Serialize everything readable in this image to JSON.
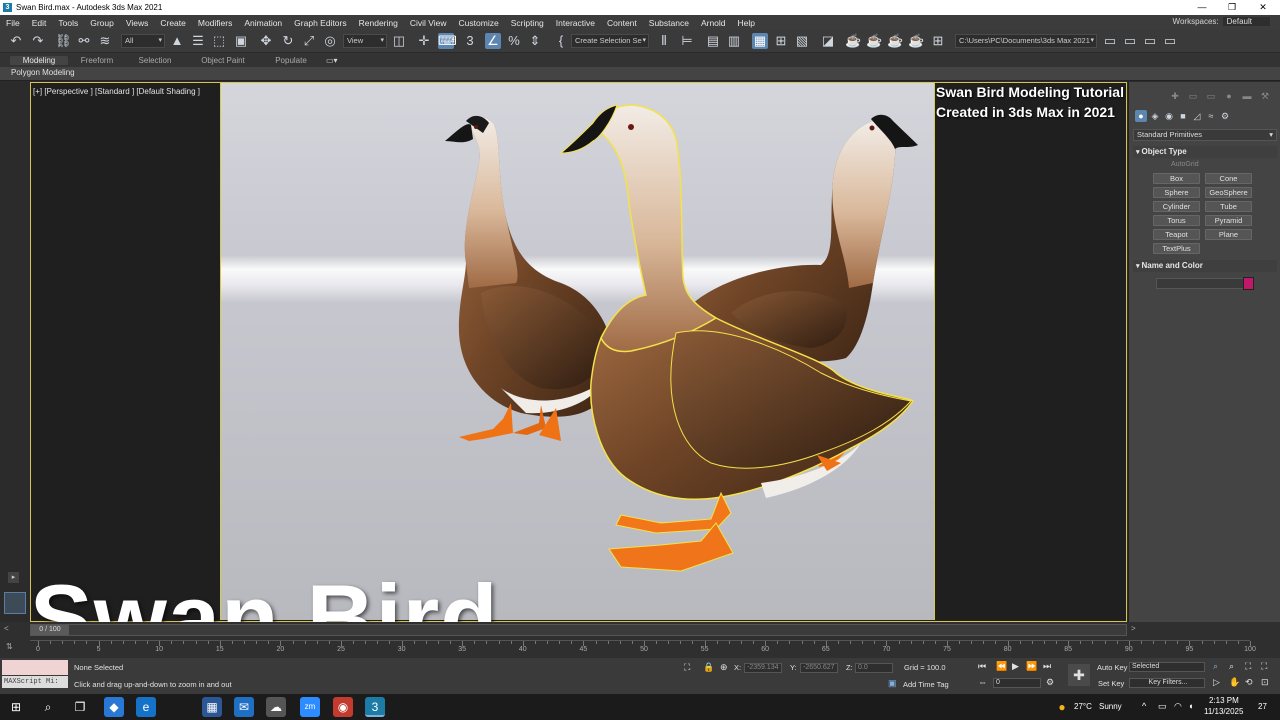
{
  "window": {
    "title": "Swan Bird.max - Autodesk 3ds Max 2021"
  },
  "menu": [
    "File",
    "Edit",
    "Tools",
    "Group",
    "Views",
    "Create",
    "Modifiers",
    "Animation",
    "Graph Editors",
    "Rendering",
    "Civil View",
    "Customize",
    "Scripting",
    "Interactive",
    "Content",
    "Substance",
    "Arnold",
    "Help"
  ],
  "workspace": {
    "label": "Workspaces:",
    "value": "Default"
  },
  "toolbar": {
    "filter": "All",
    "refcoord": "View",
    "selset": "Create Selection Se",
    "path": "C:\\Users\\PC\\Documents\\3ds Max 2021"
  },
  "ribbon": {
    "tabs": [
      "Modeling",
      "Freeform",
      "Selection",
      "Object Paint",
      "Populate"
    ],
    "panel": "Polygon Modeling"
  },
  "viewport": {
    "label": "[+] [Perspective ] [Standard ] [Default Shading ]"
  },
  "overlay": {
    "line1": "Swan Bird Modeling Tutorial design",
    "line2": "Created in 3ds Max in 2021",
    "big_title": "Swan Bird"
  },
  "command_panel": {
    "category": "Standard Primitives",
    "object_type_header": "Object Type",
    "autogrid": "AutoGrid",
    "primitives": [
      "Box",
      "Cone",
      "Sphere",
      "GeoSphere",
      "Cylinder",
      "Tube",
      "Torus",
      "Pyramid",
      "Teapot",
      "Plane",
      "TextPlus"
    ],
    "name_color_header": "Name and Color",
    "object_color": "#c0186a"
  },
  "timeline": {
    "frame": "0 / 100",
    "ticks": [
      "0",
      "5",
      "10",
      "15",
      "20",
      "25",
      "30",
      "35",
      "40",
      "45",
      "50",
      "55",
      "60",
      "65",
      "70",
      "75",
      "80",
      "85",
      "90",
      "95",
      "100"
    ]
  },
  "status": {
    "maxscript": "MAXScript Mi:",
    "selection": "None Selected",
    "prompt": "Click and drag up-and-down to zoom in and out",
    "x_label": "X:",
    "x": "-2359.134",
    "y_label": "Y:",
    "y": "-2650.627",
    "z_label": "Z:",
    "z": "0.0",
    "grid": "Grid = 100.0",
    "add_time_tag": "Add Time Tag",
    "auto_key": "Auto Key",
    "set_key": "Set Key",
    "key_mode": "Selected",
    "key_filters": "Key Filters...",
    "frame_field": "0"
  },
  "taskbar": {
    "temp": "27°C",
    "weather": "Sunny",
    "time": "2:13 PM",
    "date": "11/13/2025",
    "notif": "27"
  }
}
